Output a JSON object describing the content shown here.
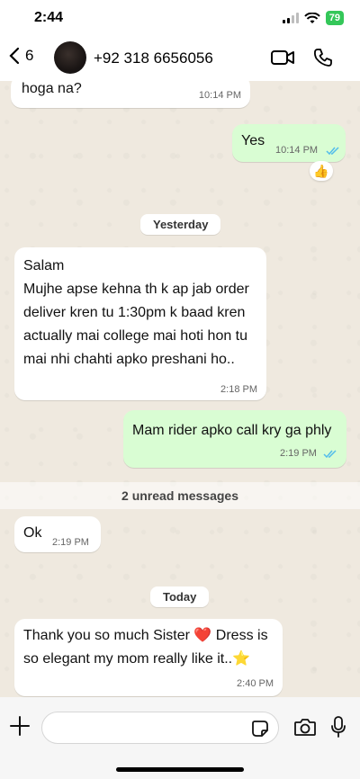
{
  "status_bar": {
    "time": "2:44",
    "battery": "79"
  },
  "header": {
    "back_count": "6",
    "contact": "+92 318 6656056"
  },
  "messages": [
    {
      "type": "in",
      "text": "hoga na?",
      "time": "10:14 PM"
    },
    {
      "type": "out",
      "text": "Yes",
      "time": "10:14 PM",
      "read": true,
      "reaction": "👍"
    },
    {
      "type": "date",
      "text": "Yesterday"
    },
    {
      "type": "in",
      "lines": [
        "Salam",
        "Mujhe apse kehna th k ap jab order",
        "deliver kren tu 1:30pm k baad kren",
        "actually mai college mai hoti hon tu",
        "mai nhi chahti apko preshani ho.."
      ],
      "time": "2:18 PM"
    },
    {
      "type": "out",
      "text": "Mam rider apko call kry ga phly",
      "time": "2:19 PM",
      "read": true
    },
    {
      "type": "unread",
      "text": "2 unread messages"
    },
    {
      "type": "in",
      "text": "Ok",
      "time": "2:19 PM"
    },
    {
      "type": "date",
      "text": "Today"
    },
    {
      "type": "in",
      "lines": [
        "Thank you so much Sister ❤️ Dress is",
        "so elegant my mom really like it..⭐"
      ],
      "time": "2:40 PM"
    }
  ],
  "colors": {
    "incoming": "#ffffff",
    "outgoing": "#d9fdd3",
    "tick": "#53bdeb"
  }
}
